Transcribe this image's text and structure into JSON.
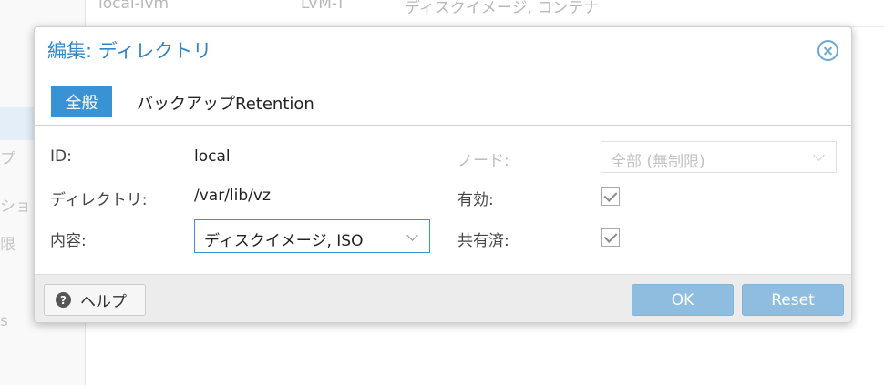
{
  "background": {
    "table_row": {
      "name": "local-lvm",
      "type": "LVM-T",
      "content": "ディスクイメージ, コンテナ"
    },
    "sidebar_fragments": [
      "プ",
      "ション",
      "限",
      "s"
    ]
  },
  "dialog": {
    "title": "編集: ディレクトリ",
    "tabs": [
      "全般",
      "バックアップRetention"
    ],
    "fields": {
      "id_label": "ID:",
      "id_value": "local",
      "directory_label": "ディレクトリ:",
      "directory_value": "/var/lib/vz",
      "content_label": "内容:",
      "content_value": "ディスクイメージ, ISO",
      "node_label": "ノード:",
      "node_value": "全部 (無制限)",
      "enabled_label": "有効:",
      "enabled": true,
      "shared_label": "共有済:",
      "shared": true
    },
    "footer": {
      "help_label": "ヘルプ",
      "ok_label": "OK",
      "reset_label": "Reset"
    }
  },
  "colors": {
    "accent": "#3892d4",
    "title": "#2f86c6",
    "button_disabled": "#8fbde0"
  }
}
